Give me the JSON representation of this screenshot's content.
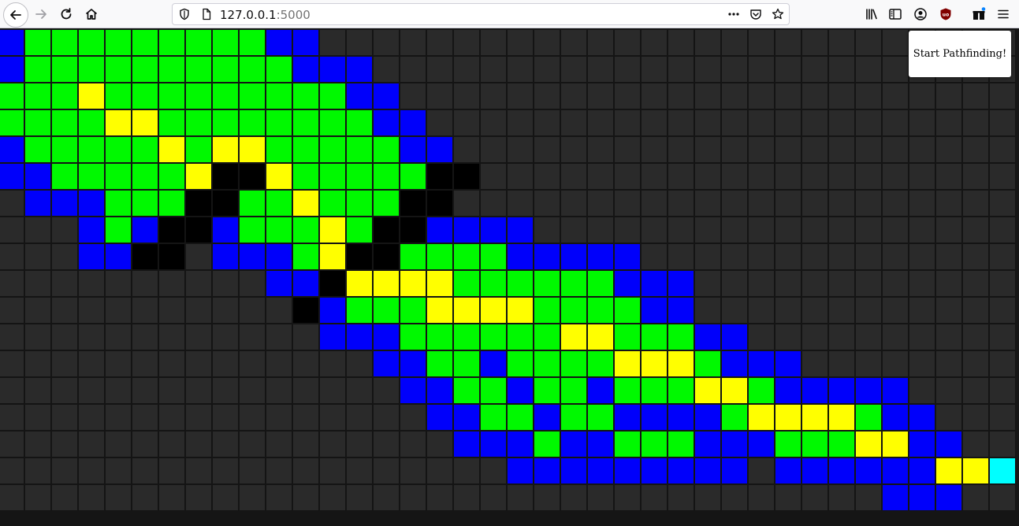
{
  "browser": {
    "url_host": "127.0.0.1",
    "url_port": ":5000",
    "icons": [
      "back-icon",
      "forward-icon",
      "reload-icon",
      "home-icon",
      "shield-icon",
      "page-icon",
      "more-icon",
      "pocket-icon",
      "star-icon",
      "library-icon",
      "sidebar-icon",
      "account-icon",
      "ublock-icon",
      "extensions-icon",
      "menu-icon"
    ]
  },
  "start_button_label": "Start Pathfinding!",
  "grid": {
    "cols": 38,
    "legend": {
      ".": "empty",
      "#": "wall",
      "G": "visited",
      "B": "frontier",
      "Y": "path",
      "C": "target"
    },
    "rows": [
      "BGGGGGGGGGBB..........................",
      "BGGGGGGGGGGBBB........................",
      "GGGYGGGGGGGGGBB.......................",
      "GGGGYYGGGGGGGGBB......................",
      "BGGGGGYGYYGGGGGBB.....................",
      "BBGGGGGY##YGGGGG##....................",
      ".BBBGGG##GGYGGG##.....................",
      "...BGB##BGGGYG##BBBB..................",
      "...BB##.BBBGY##GGGGBBBBB..............",
      "..........BB#YYYYGGGGGGBBB............",
      "...........#BGGGYYYYGGGGBB............",
      "............BBBGGGGGGYYGGGBB..........",
      "..............BBGGBGGGGYYYGBBB........",
      "...............BBGGBGGBGGGYYGBBBBB....",
      "................BBGGBGGBBBBGYYYYGBB...",
      ".................BBBGBBGGGBBBGGGYYBB..",
      "...................BBBBBBBBB.BBBBBBYYC",
      ".................................BBB.."
    ]
  },
  "colors": {
    "empty": "#2a2a2a",
    "wall": "#000000",
    "visited": "#00f900",
    "frontier": "#0000fb",
    "path": "#ffff00",
    "target": "#00ffff",
    "grid_line": "#141414"
  }
}
